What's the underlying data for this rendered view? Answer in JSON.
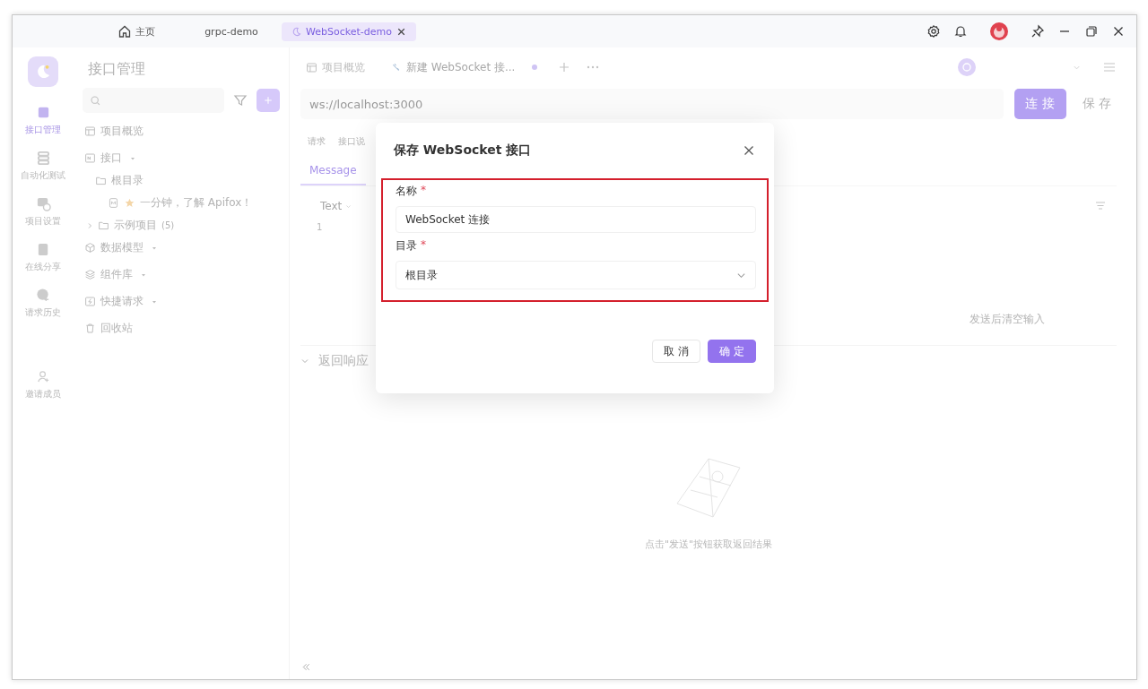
{
  "title_bar": {
    "tabs": [
      {
        "label": "主页",
        "kind": "home",
        "selected": false
      },
      {
        "label": "grpc-demo",
        "kind": "project",
        "selected": false
      },
      {
        "label": "WebSocket-demo",
        "kind": "project",
        "selected": true
      }
    ]
  },
  "rail": {
    "items": [
      {
        "label": "接口管理",
        "selected": true
      },
      {
        "label": "自动化测试",
        "selected": false
      },
      {
        "label": "项目设置",
        "selected": false
      },
      {
        "label": "在线分享",
        "selected": false
      },
      {
        "label": "请求历史",
        "selected": false
      },
      {
        "label": "邀请成员",
        "selected": false
      }
    ]
  },
  "sidebar": {
    "title": "接口管理",
    "tree": [
      {
        "label": "项目概览"
      },
      {
        "label": "接口",
        "children": [
          {
            "label": "根目录",
            "children": [
              {
                "label": "一分钟，了解 Apifox！"
              }
            ]
          },
          {
            "label": "示例项目",
            "count": "(5)"
          }
        ]
      },
      {
        "label": "数据模型"
      },
      {
        "label": "组件库"
      },
      {
        "label": "快捷请求"
      },
      {
        "label": "回收站"
      }
    ]
  },
  "main": {
    "tabs": [
      {
        "label": "项目概览",
        "kind": "overview",
        "selected": false
      },
      {
        "label": "新建 WebSocket 接...",
        "kind": "websocket",
        "selected": true,
        "unsaved": true
      }
    ],
    "url": {
      "value": "ws://localhost:3000"
    },
    "connect_button": "连 接",
    "save_button": "保 存",
    "sub_tabs": [
      {
        "label": "请求"
      },
      {
        "label": "接口说"
      }
    ],
    "message_tabs": [
      {
        "label": "Message",
        "selected": true
      }
    ],
    "format": "Text",
    "line_numbers": [
      "1"
    ],
    "clear_after_send": "发送后清空输入",
    "response": {
      "title": "返回响应",
      "empty_text": "点击\"发送\"按钮获取返回结果"
    }
  },
  "dialog": {
    "title": "保存 WebSocket 接口",
    "fields": [
      {
        "label": "名称",
        "required_mark": "*",
        "kind": "input",
        "value": "WebSocket 连接"
      },
      {
        "label": "目录",
        "required_mark": "*",
        "kind": "select",
        "value": "根目录"
      }
    ],
    "buttons": [
      {
        "label": "取 消",
        "kind": "default"
      },
      {
        "label": "确 定",
        "kind": "primary"
      }
    ]
  }
}
